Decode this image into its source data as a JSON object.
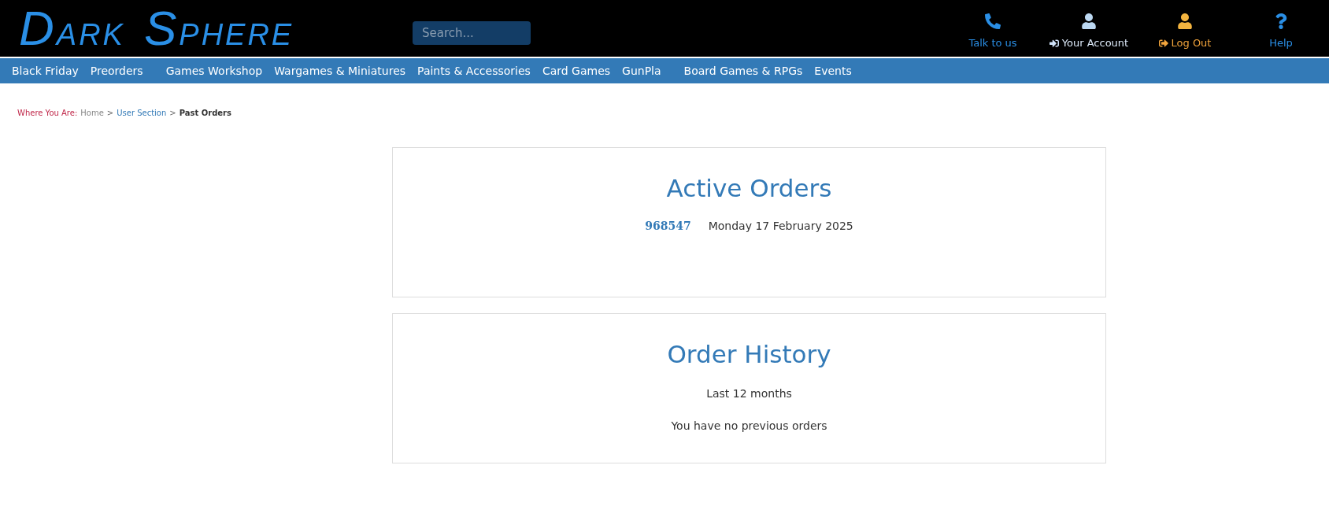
{
  "logo": [
    {
      "initial": "D",
      "rest": "ARK"
    },
    {
      "initial": "S",
      "rest": "PHERE"
    }
  ],
  "search": {
    "placeholder": "Search..."
  },
  "header_links": [
    {
      "kind": "phone",
      "label": "Talk to us"
    },
    {
      "kind": "account",
      "label": "Your Account"
    },
    {
      "kind": "logout",
      "label": "Log Out"
    },
    {
      "kind": "help",
      "label": "Help"
    }
  ],
  "nav": [
    "Black Friday",
    "Preorders",
    "Games Workshop",
    "Wargames & Miniatures",
    "Paints & Accessories",
    "Card Games",
    "GunPla",
    "Board Games & RPGs",
    "Events"
  ],
  "breadcrumb": {
    "prefix": "Where You Are:",
    "separator": ">",
    "items": [
      {
        "kind": "plain",
        "label": "Home"
      },
      {
        "kind": "link",
        "label": "User Section"
      },
      {
        "kind": "current",
        "label": "Past Orders"
      }
    ]
  },
  "active_orders": {
    "title": "Active Orders",
    "orders": [
      {
        "number": "968547",
        "date": "Monday 17 February 2025"
      }
    ]
  },
  "order_history": {
    "title": "Order History",
    "period": "Last 12 months",
    "message": "You have no previous orders"
  }
}
